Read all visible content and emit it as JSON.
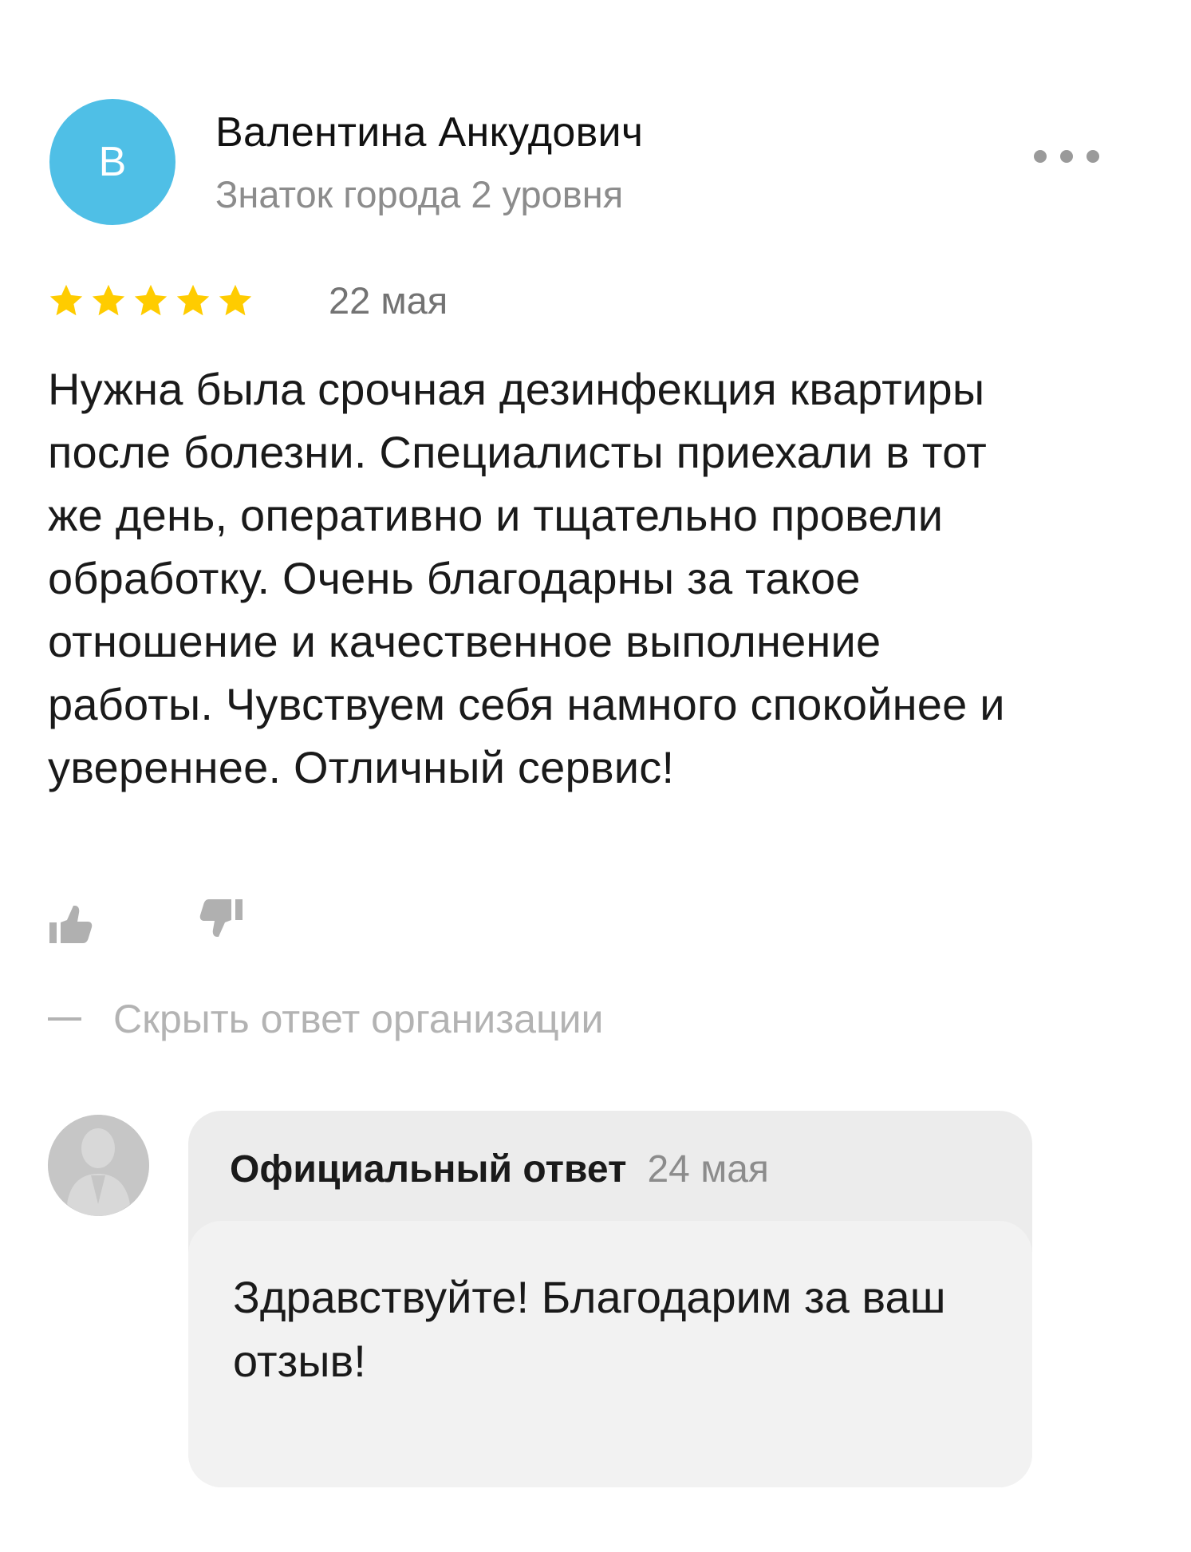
{
  "author": {
    "initial": "В",
    "name": "Валентина Анкудович",
    "level": "Знаток города 2 уровня",
    "avatar_color": "#4fbfe6"
  },
  "actions": {
    "more_icon": "ellipsis-icon",
    "like_icon": "thumbs-up-icon",
    "dislike_icon": "thumbs-down-icon"
  },
  "review": {
    "rating": 5,
    "rating_max": 5,
    "star_color": "#ffcc00",
    "date": "22 мая",
    "text": "Нужна была срочная дезинфекция квартиры после болезни. Специалисты приехали в тот же день, оперативно и тщательно провели обработку. Очень благодарны за такое отношение и качественное выполнение работы. Чувствуем себя намного спокойнее и увереннее. Отличный сервис!"
  },
  "hide_reply": {
    "label": "Скрыть ответ организации"
  },
  "reply": {
    "title": "Официальный ответ",
    "date": "24 мая",
    "text": "Здравствуйте! Благодарим за ваш отзыв!"
  }
}
